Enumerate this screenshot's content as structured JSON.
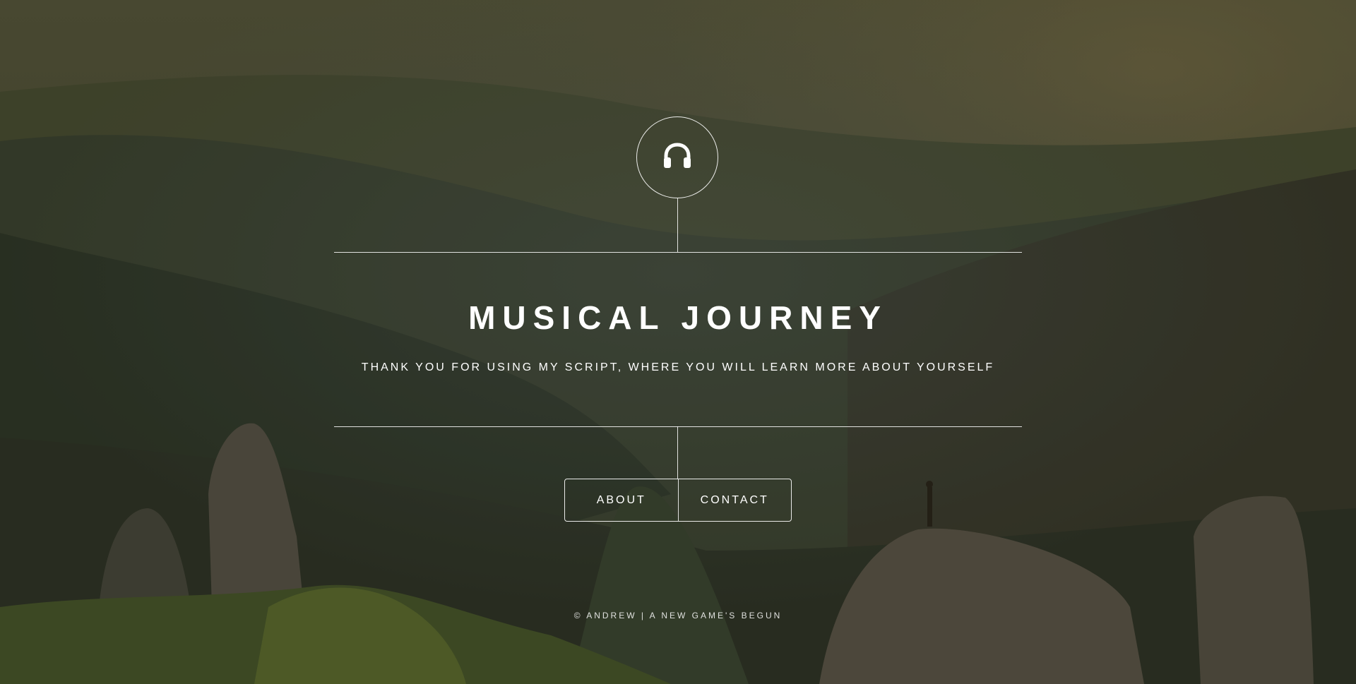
{
  "header": {
    "logo_icon": "headphones-icon",
    "title": "MUSICAL JOURNEY",
    "subtitle": "THANK YOU FOR USING MY SCRIPT, WHERE YOU WILL LEARN MORE ABOUT YOURSELF"
  },
  "nav": {
    "items": [
      {
        "label": "ABOUT"
      },
      {
        "label": "CONTACT"
      }
    ]
  },
  "footer": {
    "text": "© ANDREW | A NEW GAME'S BEGUN"
  },
  "colors": {
    "text": "#ffffff",
    "background_tint": "#3d3a2c"
  }
}
